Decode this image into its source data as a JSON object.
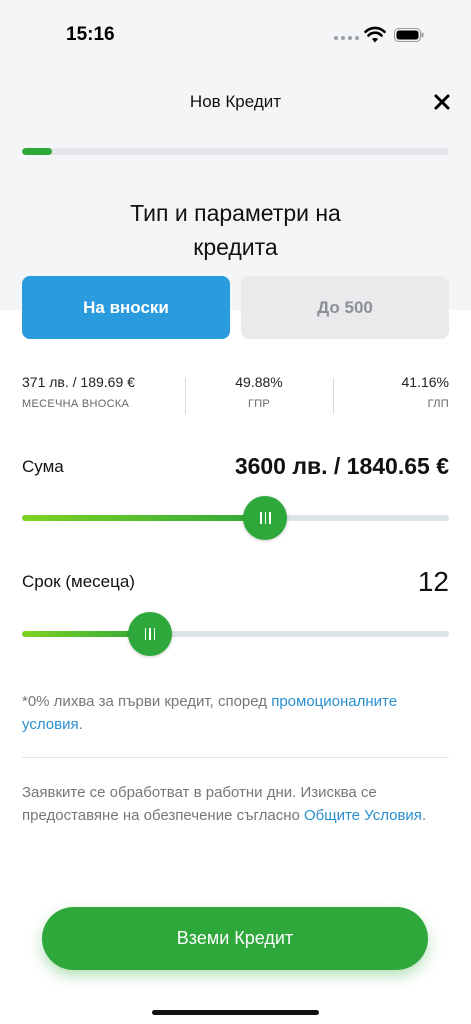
{
  "status_bar": {
    "time": "15:16"
  },
  "header": {
    "title": "Нов Кредит"
  },
  "progress": {
    "value": 0.07
  },
  "page": {
    "title_line1": "Тип и параметри на",
    "title_line2": "кредита"
  },
  "tabs": [
    {
      "label": "На вноски",
      "active": true
    },
    {
      "label": "До 500",
      "active": false
    }
  ],
  "stats": [
    {
      "value": "371 лв. / 189.69 €",
      "label": "МЕСЕЧНА ВНОСКА"
    },
    {
      "value": "49.88%",
      "label": "ГПР"
    },
    {
      "value": "41.16%",
      "label": "ГЛП"
    }
  ],
  "amount": {
    "label": "Сума",
    "value": "3600 лв. / 1840.65 €",
    "fill": 0.57
  },
  "term": {
    "label": "Срок (месеца)",
    "value": "12",
    "fill": 0.3
  },
  "promo": {
    "text": "*0% лихва за първи кредит, според ",
    "link": "промоционалните условия",
    "suffix": "."
  },
  "info": {
    "text": "Заявките се обработват в работни дни. Изисква се предоставяне на обезпечение съгласно ",
    "link": "Общите Условия",
    "suffix": "."
  },
  "cta": {
    "label": "Вземи Кредит"
  },
  "colors": {
    "accent_green": "#2ea83a",
    "accent_blue": "#2a9bdc",
    "link": "#2a8fcf"
  }
}
